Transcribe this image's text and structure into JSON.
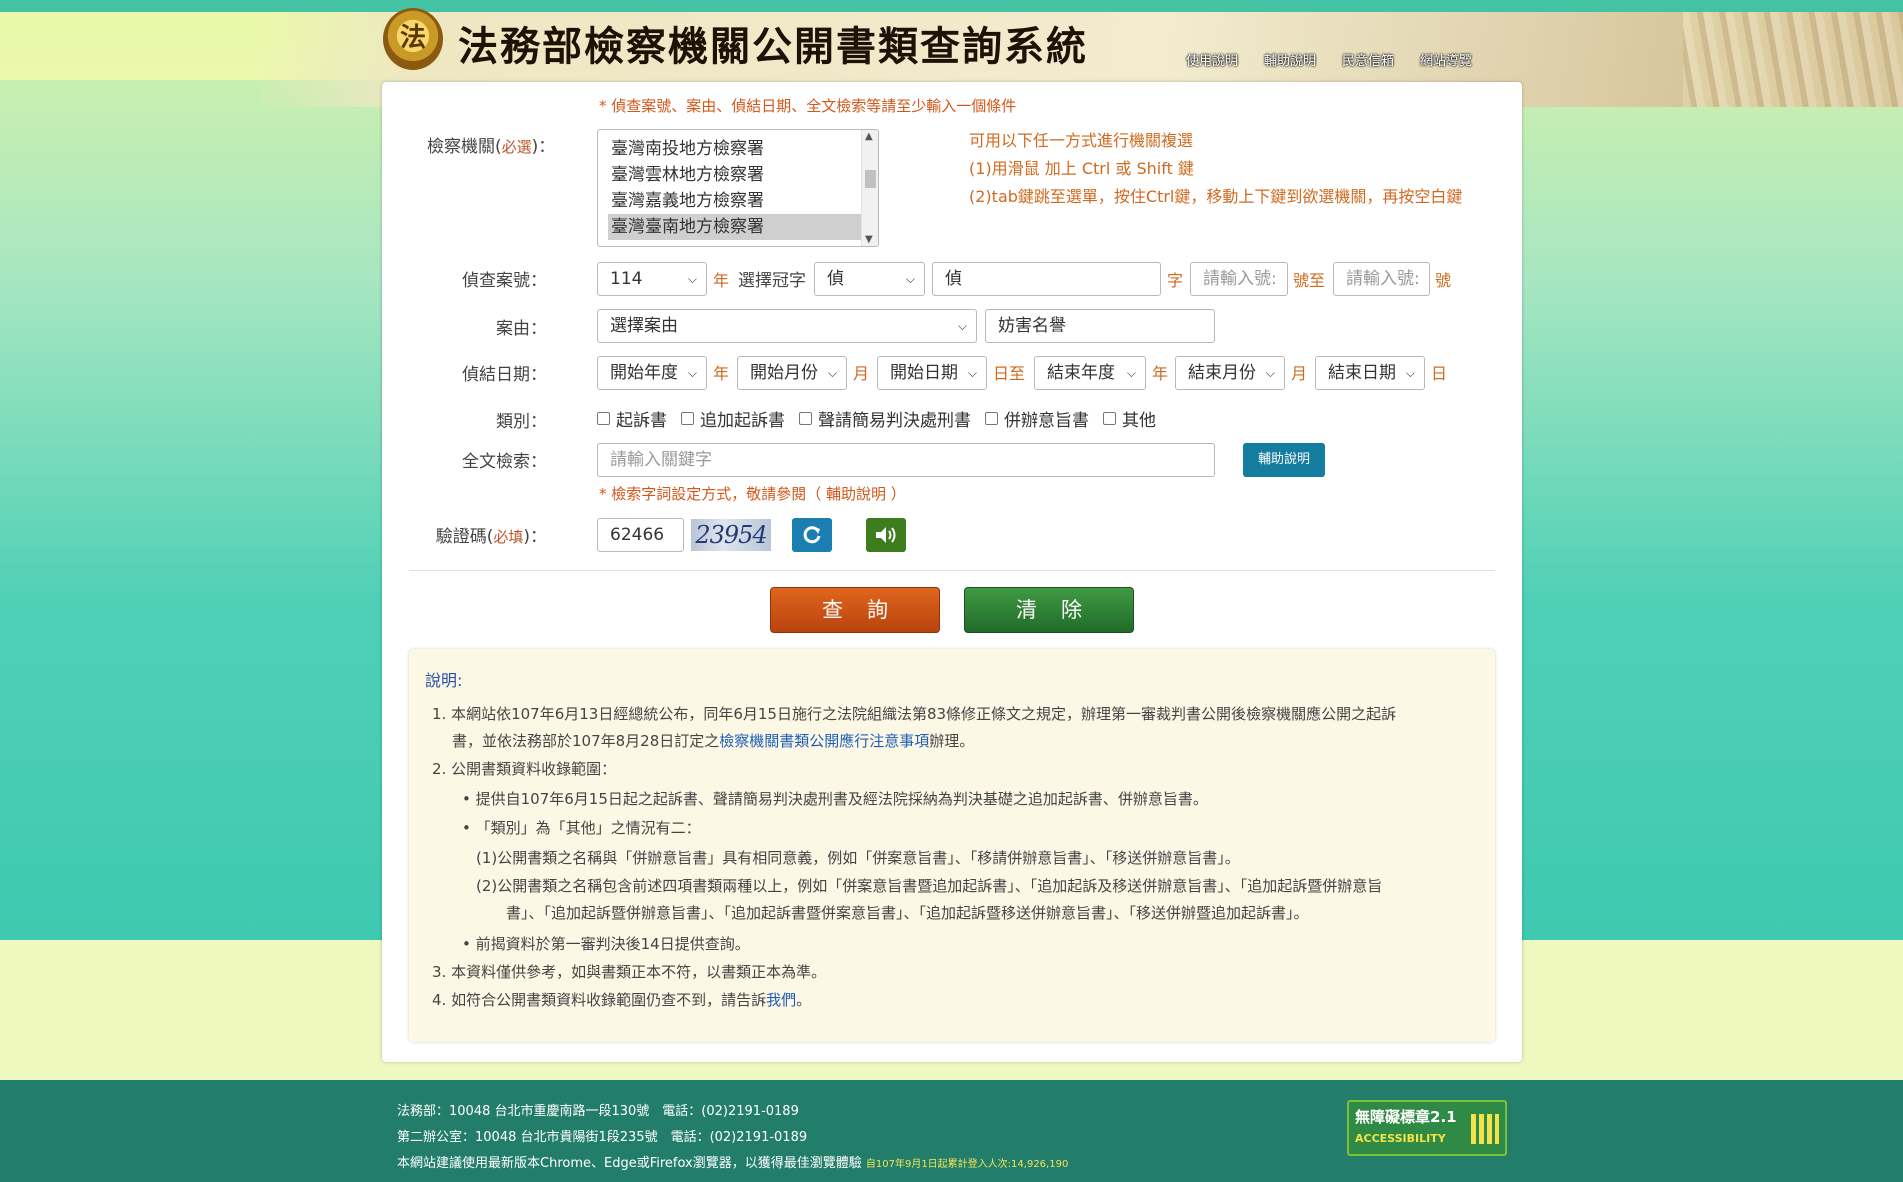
{
  "header": {
    "logo_char": "法",
    "title": "法務部檢察機關公開書類查詢系統",
    "nav": [
      "使用說明",
      "輔助說明",
      "民意信箱",
      "網站導覽"
    ]
  },
  "form": {
    "top_hint": "* 偵查案號、案由、偵結日期、全文檢索等請至少輸入一個條件",
    "agency": {
      "label": "檢察機關(",
      "required": "必選",
      "label_end": ")：",
      "options": [
        "臺灣南投地方檢察署",
        "臺灣雲林地方檢察署",
        "臺灣嘉義地方檢察署",
        "臺灣臺南地方檢察署"
      ],
      "selected_index": 3,
      "tips": [
        "可用以下任一方式進行機關複選",
        "(1)用滑鼠 加上 Ctrl 或 Shift 鍵",
        "(2)tab鍵跳至選單，按住Ctrl鍵，移動上下鍵到欲選機關，再按空白鍵"
      ]
    },
    "case_no": {
      "label": "偵查案號：",
      "year_value": "114",
      "year_unit": "年",
      "prefix_label": "選擇冠字",
      "prefix_value": "偵",
      "word_value": "偵",
      "word_unit": "字",
      "num_from_placeholder": "請輸入號:",
      "num_from_unit": "號至",
      "num_to_placeholder": "請輸入號:",
      "num_to_unit": "號"
    },
    "cause": {
      "label": "案由：",
      "select_value": "選擇案由",
      "input_value": "妨害名譽"
    },
    "date": {
      "label": "偵結日期：",
      "start_year": "開始年度",
      "u_year": "年",
      "start_month": "開始月份",
      "u_month": "月",
      "start_day": "開始日期",
      "u_day_to": "日至",
      "end_year": "結束年度",
      "u_year2": "年",
      "end_month": "結束月份",
      "u_month2": "月",
      "end_day": "結束日期",
      "u_day": "日"
    },
    "category": {
      "label": "類別：",
      "options": [
        "起訴書",
        "追加起訴書",
        "聲請簡易判決處刑書",
        "併辦意旨書",
        "其他"
      ]
    },
    "fulltext": {
      "label": "全文檢索：",
      "placeholder": "請輸入關鍵字",
      "help_button": "輔助說明",
      "hint": "* 檢索字詞設定方式，敬請參閱（ 輔助說明 ）"
    },
    "captcha": {
      "label": "驗證碼(",
      "required": "必填",
      "label_end": ")：",
      "value": "62466",
      "image_text": "23954"
    },
    "buttons": {
      "search": "查詢",
      "clear": "清除"
    }
  },
  "notes": {
    "title": "說明:",
    "n1a": "1. 本網站依107年6月13日經總統公布，同年6月15日施行之法院組織法第83條修正條文之規定，辦理第一審裁判書公開後檢察機關應公開之起訴",
    "n1b_pre": "書，並依法務部於107年8月28日訂定之",
    "n1b_link": "檢察機關書類公開應行注意事項",
    "n1b_post": "辦理。",
    "n2": "2. 公開書類資料收錄範圍：",
    "b1": "提供自107年6月15日起之起訴書、聲請簡易判決處刑書及經法院採納為判決基礎之追加起訴書、併辦意旨書。",
    "b2": "「類別」為「其他」之情況有二：",
    "s1": "(1)公開書類之名稱與「併辦意旨書」具有相同意義，例如「併案意旨書」、「移請併辦意旨書」、「移送併辦意旨書」。",
    "s2a": "(2)公開書類之名稱包含前述四項書類兩種以上，例如「併案意旨書暨追加起訴書」、「追加起訴及移送併辦意旨書」、「追加起訴暨併辦意旨",
    "s2b": "書」、「追加起訴暨併辦意旨書」、「追加起訴書暨併案意旨書」、「追加起訴暨移送併辦意旨書」、「移送併辦暨追加起訴書」。",
    "b3": "前揭資料於第一審判決後14日提供查詢。",
    "n3": "3. 本資料僅供參考，如與書類正本不符，以書類正本為準。",
    "n4_pre": "4. 如符合公開書類資料收錄範圍仍查不到，請告訴",
    "n4_link": "我們",
    "n4_post": "。"
  },
  "footer": {
    "line1": "法務部：10048 台北市重慶南路一段130號　電話：(02)2191-0189",
    "line2": "第二辦公室：10048 台北市貴陽街1段235號　電話：(02)2191-0189",
    "line3": "本網站建議使用最新版本Chrome、Edge或Firefox瀏覽器，以獲得最佳瀏覽體驗",
    "counter": "自107年9月1日起累計登入人次:14,926,190",
    "badge_title": "無障礙標章2.1",
    "badge_sub": "ACCESSIBILITY"
  }
}
